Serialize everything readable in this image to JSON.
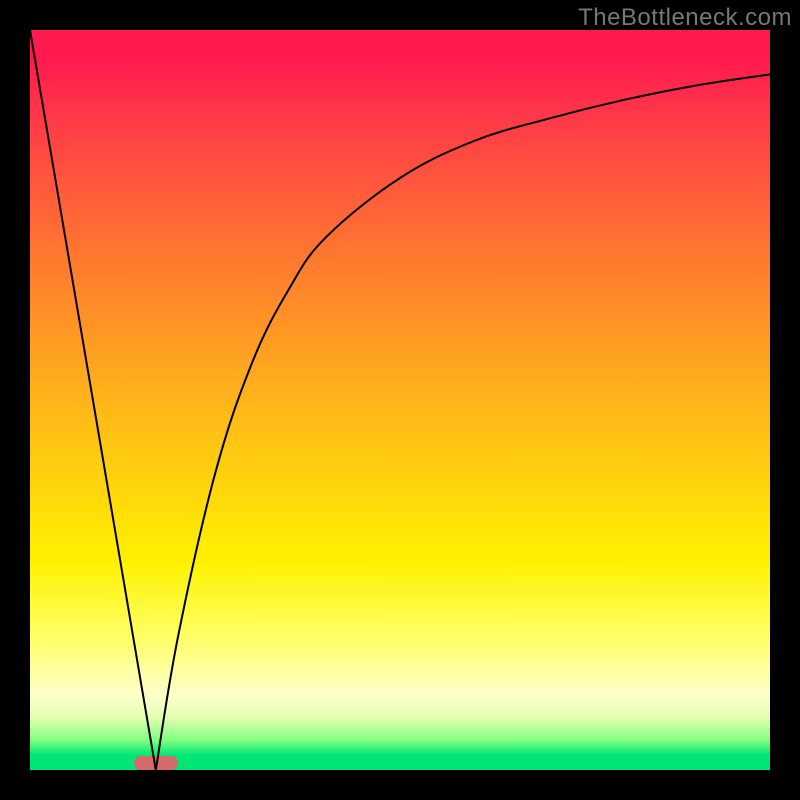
{
  "watermark": "TheBottleneck.com",
  "colors": {
    "frame": "#000000",
    "marker": "#d46a6a",
    "curve": "#000000"
  },
  "chart_data": {
    "type": "line",
    "title": "",
    "xlabel": "",
    "ylabel": "",
    "xlim": [
      0,
      100
    ],
    "ylim": [
      0,
      100
    ],
    "grid": false,
    "background": "red-yellow-green vertical gradient (bottleneck heatmap)",
    "description": "V-shaped bottleneck curve: sharp linear drop from top-left to a minimum near x≈17, then asymptotic rise toward top-right.",
    "series": [
      {
        "name": "left-slope",
        "x": [
          0,
          17
        ],
        "y": [
          100,
          0
        ]
      },
      {
        "name": "right-curve",
        "x": [
          17,
          20,
          25,
          30,
          35,
          40,
          50,
          60,
          70,
          80,
          90,
          100
        ],
        "y": [
          0,
          18,
          40,
          55,
          65,
          72,
          80,
          85,
          88,
          90.5,
          92.5,
          94
        ]
      }
    ],
    "marker": {
      "x_center": 17,
      "x_width": 6,
      "y": 0
    }
  }
}
